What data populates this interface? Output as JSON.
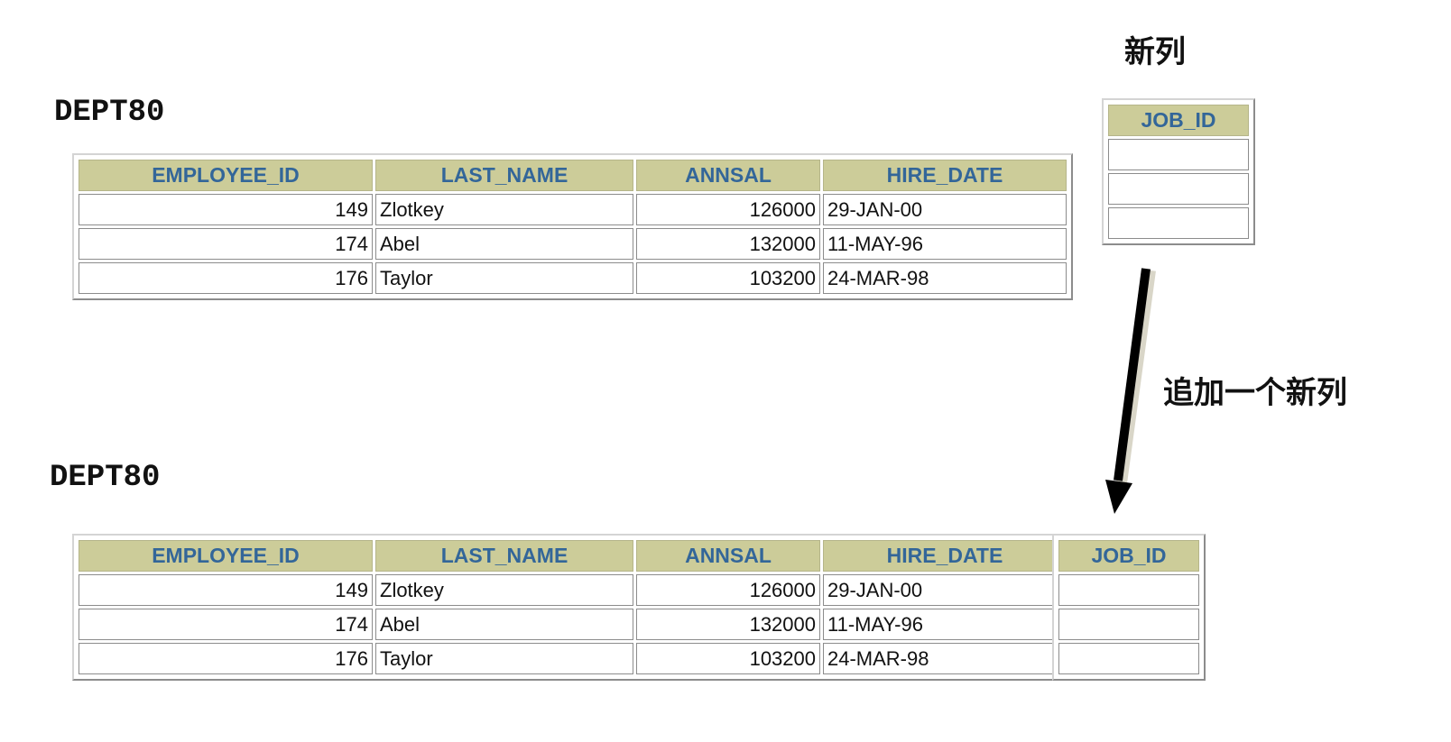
{
  "new_column": {
    "label": "新列",
    "header": "JOB_ID",
    "rows": [
      "",
      "",
      ""
    ]
  },
  "top_table": {
    "title": "DEPT80",
    "headers": [
      "EMPLOYEE_ID",
      "LAST_NAME",
      "ANNSAL",
      "HIRE_DATE"
    ],
    "rows": [
      {
        "employee_id": "149",
        "last_name": "Zlotkey",
        "annsal": "126000",
        "hire_date": "29-JAN-00"
      },
      {
        "employee_id": "174",
        "last_name": "Abel",
        "annsal": "132000",
        "hire_date": "11-MAY-96"
      },
      {
        "employee_id": "176",
        "last_name": "Taylor",
        "annsal": "103200",
        "hire_date": "24-MAR-98"
      }
    ]
  },
  "arrow_label": "追加一个新列",
  "bottom_table": {
    "title": "DEPT80",
    "headers": [
      "EMPLOYEE_ID",
      "LAST_NAME",
      "ANNSAL",
      "HIRE_DATE"
    ],
    "job_header": "JOB_ID",
    "rows": [
      {
        "employee_id": "149",
        "last_name": "Zlotkey",
        "annsal": "126000",
        "hire_date": "29-JAN-00",
        "job_id": ""
      },
      {
        "employee_id": "174",
        "last_name": "Abel",
        "annsal": "132000",
        "hire_date": "11-MAY-96",
        "job_id": ""
      },
      {
        "employee_id": "176",
        "last_name": "Taylor",
        "annsal": "103200",
        "hire_date": "24-MAR-98",
        "job_id": ""
      }
    ]
  },
  "colors": {
    "header_bg": "#cccc99",
    "header_text": "#336699",
    "arrow": "#000000"
  }
}
